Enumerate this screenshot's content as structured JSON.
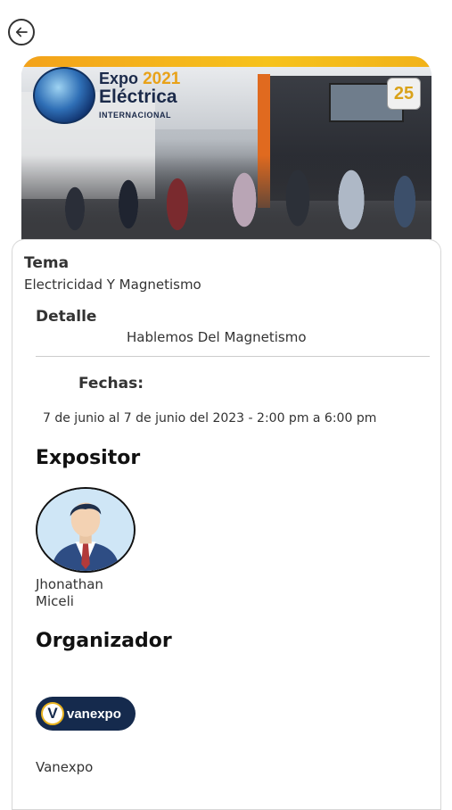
{
  "header": {
    "back_icon": "arrow-left-icon"
  },
  "banner": {
    "logo": {
      "expo": "Expo",
      "year": "2021",
      "electrica": "Eléctrica",
      "internacional": "INTERNACIONAL"
    },
    "anniversary_badge": "25",
    "colors": {
      "accent": "#f3a21b",
      "brand_navy": "#1b2a4a"
    }
  },
  "event": {
    "tema_label": "Tema",
    "tema_value": "Electricidad Y Magnetismo",
    "detalle_label": "Detalle",
    "detalle_value": "Hablemos Del Magnetismo",
    "fechas_label": "Fechas:",
    "fechas_value": "7 de junio al 7 de junio del 2023 - 2:00 pm a 6:00 pm"
  },
  "expositor": {
    "heading": "Expositor",
    "avatar_icon": "person-avatar-icon",
    "name_first": "Jhonathan",
    "name_last": "Miceli"
  },
  "organizador": {
    "heading": "Organizador",
    "logo_letter": "V",
    "logo_word": "vanexpo",
    "name": "Vanexpo"
  }
}
